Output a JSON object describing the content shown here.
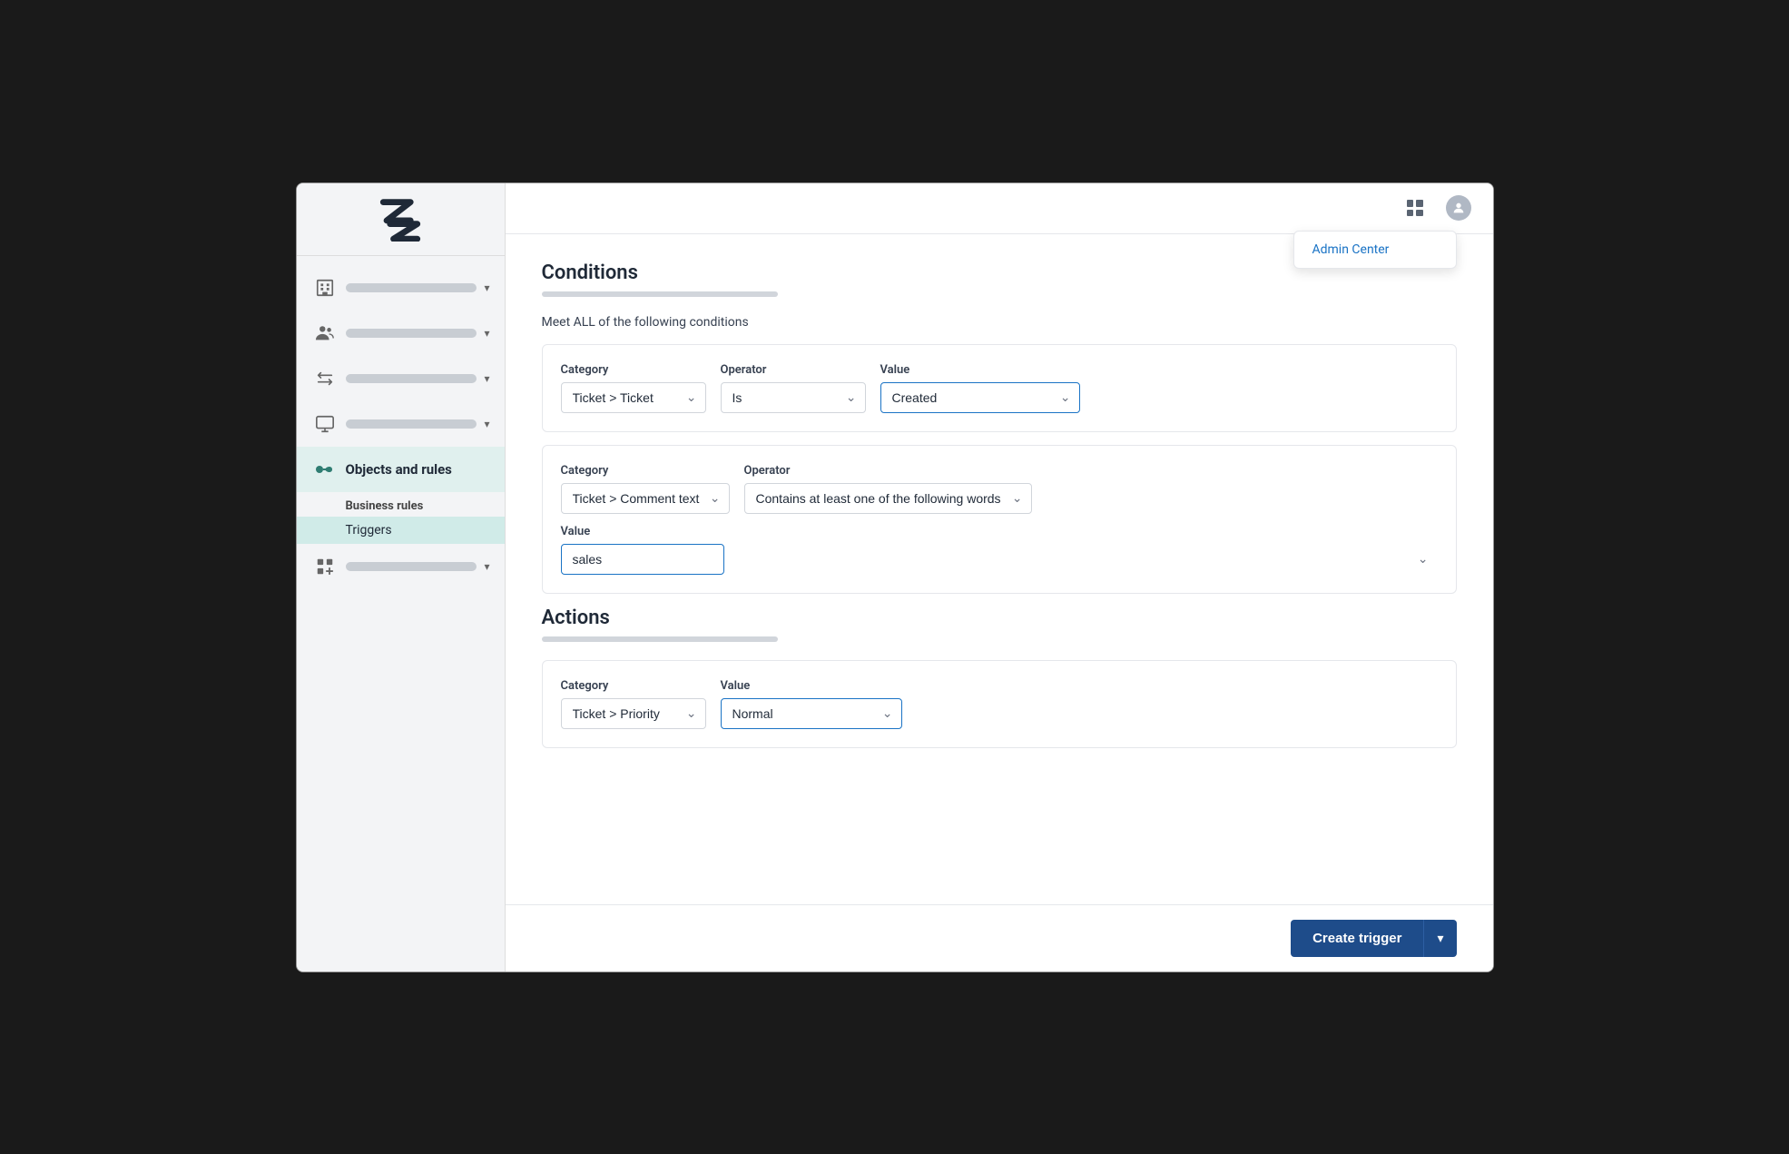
{
  "sidebar": {
    "logo_alt": "Zendesk",
    "nav_items": [
      {
        "id": "workspace",
        "icon": "building",
        "active": false
      },
      {
        "id": "people",
        "icon": "people",
        "active": false
      },
      {
        "id": "channels",
        "icon": "arrows",
        "active": false
      },
      {
        "id": "workspaces",
        "icon": "monitor",
        "active": false
      },
      {
        "id": "objects",
        "icon": "objects",
        "active": true,
        "label": "Objects and rules"
      },
      {
        "id": "apps",
        "icon": "apps",
        "active": false
      }
    ],
    "active_section_label": "Objects and rules",
    "business_rules_label": "Business rules",
    "triggers_label": "Triggers"
  },
  "topbar": {
    "grid_icon_alt": "apps-grid",
    "user_icon_alt": "user-profile",
    "admin_center_label": "Admin Center"
  },
  "conditions": {
    "title": "Conditions",
    "meet_text": "Meet ALL of the following conditions",
    "rows": [
      {
        "category_label": "Category",
        "category_value": "Ticket > Ticket",
        "operator_label": "Operator",
        "operator_value": "Is",
        "value_label": "Value",
        "value_value": "Created",
        "value_focused": true
      },
      {
        "category_label": "Category",
        "category_value": "Ticket > Comment text",
        "operator_label": "Operator",
        "operator_value": "Contains at least one of the following words",
        "value_label": "Value",
        "value_value": "sales",
        "value_focused": true
      }
    ]
  },
  "actions": {
    "title": "Actions",
    "rows": [
      {
        "category_label": "Category",
        "category_value": "Ticket > Priority",
        "value_label": "Value",
        "value_value": "Normal",
        "value_focused": true
      }
    ]
  },
  "footer": {
    "create_btn_label": "Create trigger",
    "arrow_label": "▾"
  }
}
